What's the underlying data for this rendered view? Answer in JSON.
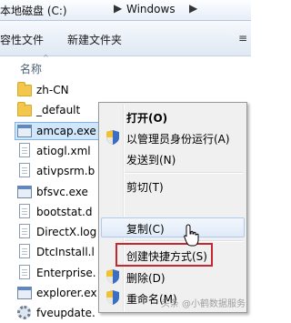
{
  "address": {
    "drive": "本地磁盘 (C:)",
    "folder": "Windows",
    "sep": "▶"
  },
  "toolbar": {
    "include": "容性文件",
    "new_folder": "新建文件夹",
    "more": "≡"
  },
  "column": {
    "name": "名称",
    "sort_arrow": "^"
  },
  "files": [
    {
      "name": "zh-CN",
      "icon": "folder-icon"
    },
    {
      "name": "_default",
      "icon": "folder-icon"
    },
    {
      "name": "amcap.exe",
      "icon": "application-icon"
    },
    {
      "name": "atiogl.xml",
      "icon": "document-icon"
    },
    {
      "name": "ativpsrm.b",
      "icon": "document-icon"
    },
    {
      "name": "bfsvc.exe",
      "icon": "application-icon"
    },
    {
      "name": "bootstat.d",
      "icon": "document-icon"
    },
    {
      "name": "DirectX.log",
      "icon": "document-icon"
    },
    {
      "name": "DtcInstall.l",
      "icon": "document-icon"
    },
    {
      "name": "Enterprise.",
      "icon": "document-icon"
    },
    {
      "name": "explorer.ex",
      "icon": "application-icon"
    },
    {
      "name": "fveupdate.",
      "icon": "gear-icon"
    }
  ],
  "menu": {
    "open": "打开(O)",
    "run_as_admin": "以管理员身份运行(A)",
    "send_to": "发送到(N)",
    "cut": "剪切(T)",
    "copy": "复制(C)",
    "create_shortcut": "创建快捷方式(S)",
    "delete": "删除(D)",
    "rename": "重命名(M)"
  },
  "watermark": "头条 @小鹤数据服务",
  "colors": {
    "highlight": "#c8282d",
    "selection": "#cfe6fb",
    "menu_bg": "#f0f0f0"
  }
}
